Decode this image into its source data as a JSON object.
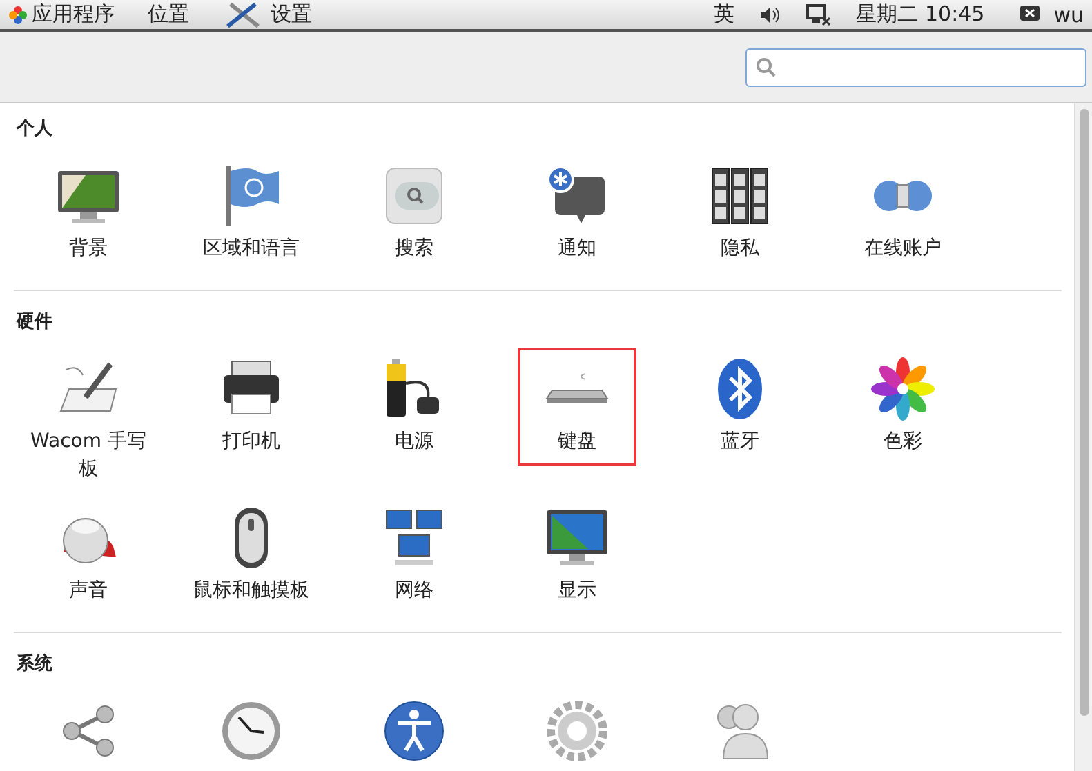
{
  "top_bar": {
    "menus": [
      {
        "label": "应用程序",
        "kind": "apps"
      },
      {
        "label": "位置",
        "kind": "plain"
      },
      {
        "label": "设置",
        "kind": "settings"
      }
    ],
    "input_method": "英",
    "clock": "星期二 10:45",
    "user": "wu"
  },
  "sections": [
    {
      "title": "个人",
      "items": [
        {
          "label": "背景",
          "kind": "background",
          "highlighted": false
        },
        {
          "label": "区域和语言",
          "kind": "flag",
          "highlighted": false
        },
        {
          "label": "搜索",
          "kind": "search",
          "highlighted": false
        },
        {
          "label": "通知",
          "kind": "notification",
          "highlighted": false
        },
        {
          "label": "隐私",
          "kind": "privacy",
          "highlighted": false
        },
        {
          "label": "在线账户",
          "kind": "online",
          "highlighted": false
        }
      ]
    },
    {
      "title": "硬件",
      "items": [
        {
          "label": "Wacom 手写板",
          "kind": "wacom",
          "highlighted": false
        },
        {
          "label": "打印机",
          "kind": "printer",
          "highlighted": false
        },
        {
          "label": "电源",
          "kind": "power",
          "highlighted": false
        },
        {
          "label": "键盘",
          "kind": "keyboard",
          "highlighted": true
        },
        {
          "label": "蓝牙",
          "kind": "bluetooth",
          "highlighted": false
        },
        {
          "label": "色彩",
          "kind": "color",
          "highlighted": false
        },
        {
          "label": "声音",
          "kind": "sound",
          "highlighted": false
        },
        {
          "label": "鼠标和触摸板",
          "kind": "mouse",
          "highlighted": false
        },
        {
          "label": "网络",
          "kind": "network",
          "highlighted": false
        },
        {
          "label": "显示",
          "kind": "display",
          "highlighted": false
        }
      ]
    },
    {
      "title": "系统",
      "items": [
        {
          "kind": "share",
          "highlighted": false
        },
        {
          "kind": "clock",
          "highlighted": false
        },
        {
          "kind": "accessibility",
          "highlighted": false
        },
        {
          "kind": "gear",
          "highlighted": false
        },
        {
          "kind": "users",
          "highlighted": false
        }
      ]
    }
  ]
}
